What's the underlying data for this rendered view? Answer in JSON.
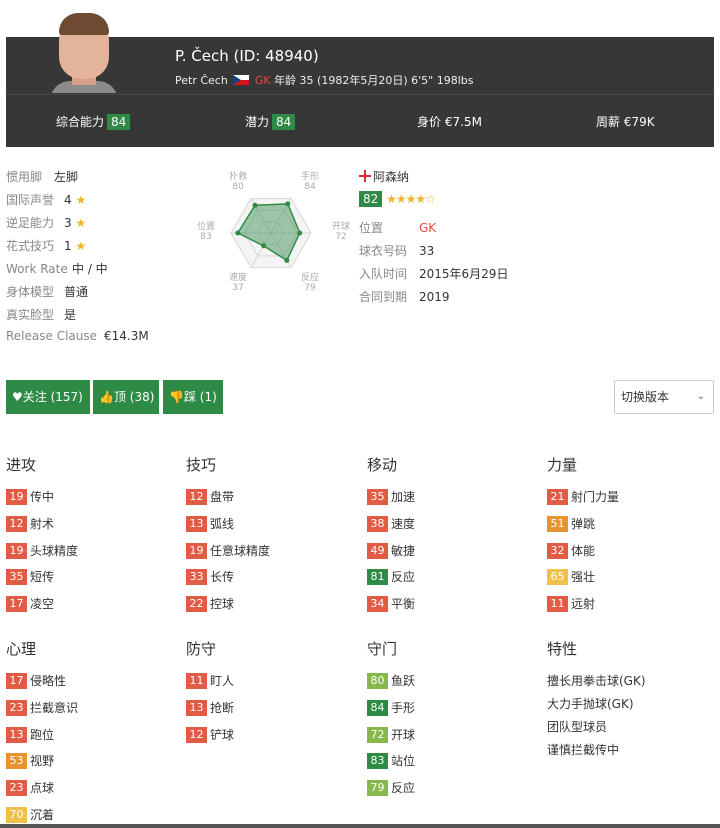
{
  "player": {
    "name": "P. Čech (ID: 48940)",
    "full_name": "Petr Čech",
    "position": "GK",
    "age_text": "年龄 35 (1982年5月20日) 6'5\" 198lbs"
  },
  "stats_bar": [
    {
      "label": "综合能力",
      "value": "84"
    },
    {
      "label": "潜力",
      "value": "84"
    },
    {
      "label": "身价",
      "value": "€7.5M"
    },
    {
      "label": "周薪",
      "value": "€79K"
    }
  ],
  "info": [
    {
      "label": "惯用脚",
      "value": "左脚"
    },
    {
      "label": "国际声誉",
      "value": "4"
    },
    {
      "label": "逆足能力",
      "value": "3"
    },
    {
      "label": "花式技巧",
      "value": "1"
    },
    {
      "label": "Work Rate",
      "value": "中 / 中"
    },
    {
      "label": "身体模型",
      "value": "普通"
    },
    {
      "label": "真实脸型",
      "value": "是"
    },
    {
      "label": "Release Clause",
      "value": "€14.3M"
    }
  ],
  "star_glyph": "★",
  "radar": {
    "labels": [
      {
        "name": "扑救",
        "value": "80"
      },
      {
        "name": "手形",
        "value": "84"
      },
      {
        "name": "开球",
        "value": "72"
      },
      {
        "name": "反应",
        "value": "79"
      },
      {
        "name": "速度",
        "value": "37"
      },
      {
        "name": "位置",
        "value": "83"
      }
    ],
    "values": [
      80,
      84,
      72,
      79,
      37,
      83
    ],
    "max": 100
  },
  "club": {
    "name": "阿森纳",
    "rating": "82",
    "stars": "★★★★☆",
    "rows": [
      {
        "label": "位置",
        "value": "GK"
      },
      {
        "label": "球衣号码",
        "value": "33"
      },
      {
        "label": "入队时间",
        "value": "2015年6月29日"
      },
      {
        "label": "合同到期",
        "value": "2019"
      }
    ]
  },
  "buttons": {
    "follow": "关注 (157)",
    "like": "顶 (38)",
    "dislike": "踩 (1)",
    "version": "切换版本"
  },
  "colors": {
    "green": "#2e8b46",
    "red": "#e25c45",
    "orange": "#e69330",
    "yellow": "#f0c04a",
    "light_green": "#87b84b"
  },
  "categories": [
    {
      "title": "进攻",
      "attrs": [
        {
          "v": "19",
          "n": "传中",
          "c": "red"
        },
        {
          "v": "12",
          "n": "射术",
          "c": "red"
        },
        {
          "v": "19",
          "n": "头球精度",
          "c": "red"
        },
        {
          "v": "35",
          "n": "短传",
          "c": "red"
        },
        {
          "v": "17",
          "n": "凌空",
          "c": "red"
        }
      ]
    },
    {
      "title": "技巧",
      "attrs": [
        {
          "v": "12",
          "n": "盘带",
          "c": "red"
        },
        {
          "v": "13",
          "n": "弧线",
          "c": "red"
        },
        {
          "v": "19",
          "n": "任意球精度",
          "c": "red"
        },
        {
          "v": "33",
          "n": "长传",
          "c": "red"
        },
        {
          "v": "22",
          "n": "控球",
          "c": "red"
        }
      ]
    },
    {
      "title": "移动",
      "attrs": [
        {
          "v": "35",
          "n": "加速",
          "c": "red"
        },
        {
          "v": "38",
          "n": "速度",
          "c": "red"
        },
        {
          "v": "49",
          "n": "敏捷",
          "c": "red"
        },
        {
          "v": "81",
          "n": "反应",
          "c": "dgreen"
        },
        {
          "v": "34",
          "n": "平衡",
          "c": "red"
        }
      ]
    },
    {
      "title": "力量",
      "attrs": [
        {
          "v": "21",
          "n": "射门力量",
          "c": "red"
        },
        {
          "v": "51",
          "n": "弹跳",
          "c": "orange"
        },
        {
          "v": "32",
          "n": "体能",
          "c": "red"
        },
        {
          "v": "65",
          "n": "强壮",
          "c": "yellow"
        },
        {
          "v": "11",
          "n": "远射",
          "c": "red"
        }
      ]
    },
    {
      "title": "心理",
      "attrs": [
        {
          "v": "17",
          "n": "侵略性",
          "c": "red"
        },
        {
          "v": "23",
          "n": "拦截意识",
          "c": "red"
        },
        {
          "v": "13",
          "n": "跑位",
          "c": "red"
        },
        {
          "v": "53",
          "n": "视野",
          "c": "orange"
        },
        {
          "v": "23",
          "n": "点球",
          "c": "red"
        },
        {
          "v": "70",
          "n": "沉着",
          "c": "yellow"
        }
      ]
    },
    {
      "title": "防守",
      "attrs": [
        {
          "v": "11",
          "n": "盯人",
          "c": "red"
        },
        {
          "v": "13",
          "n": "抢断",
          "c": "red"
        },
        {
          "v": "12",
          "n": "铲球",
          "c": "red"
        }
      ]
    },
    {
      "title": "守门",
      "attrs": [
        {
          "v": "80",
          "n": "鱼跃",
          "c": "lgreen"
        },
        {
          "v": "84",
          "n": "手形",
          "c": "dgreen"
        },
        {
          "v": "72",
          "n": "开球",
          "c": "lgreen"
        },
        {
          "v": "83",
          "n": "站位",
          "c": "dgreen"
        },
        {
          "v": "79",
          "n": "反应",
          "c": "lgreen"
        }
      ]
    }
  ],
  "traits": {
    "title": "特性",
    "items": [
      "擅长用拳击球(GK)",
      "大力手抛球(GK)",
      "团队型球员",
      "谨慎拦截传中"
    ]
  }
}
